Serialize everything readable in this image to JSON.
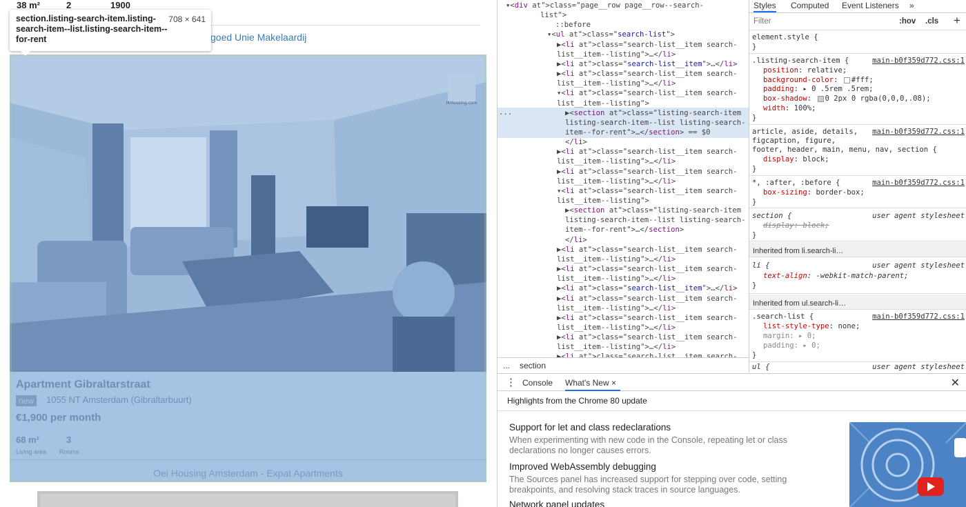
{
  "page": {
    "prev_listing": {
      "area": "38 m²",
      "rooms": "2",
      "price_short": "1900",
      "agent_partial": "goed Unie Makelaardij"
    },
    "tooltip": {
      "selector": "section.listing-search-item.listing-search-item--list.listing-search-item--for-rent",
      "dimensions": "708 × 641"
    },
    "listing": {
      "title": "Apartment Gibraltarstraat",
      "badge": "new",
      "address": "1055 NT Amsterdam (Gibraltarbuurt)",
      "price": "€1,900 per month",
      "area": "68 m²",
      "area_label": "Living area",
      "rooms": "3",
      "rooms_label": "Rooms",
      "agent": "Oei Housing Amsterdam - Expat Apartments",
      "watermark": "IKHousing.com"
    }
  },
  "devtools": {
    "elements": [
      {
        "indent": 12,
        "html": "▾<div class=\"page__row page__row--search-"
      },
      {
        "indent": 62,
        "html": "list\">"
      },
      {
        "indent": 84,
        "html": "::before"
      },
      {
        "indent": 72,
        "html": "▾<ul class=\"search-list\">"
      },
      {
        "indent": 86,
        "html": "▶<li class=\"search-list__item search-"
      },
      {
        "indent": 86,
        "html": "list__item--listing\">…</li>"
      },
      {
        "indent": 86,
        "html": "▶<li class=\"search-list__item\">…</li>"
      },
      {
        "indent": 86,
        "html": "▶<li class=\"search-list__item search-"
      },
      {
        "indent": 86,
        "html": "list__item--listing\">…</li>"
      },
      {
        "indent": 86,
        "html": "▾<li class=\"search-list__item search-"
      },
      {
        "indent": 86,
        "html": "list__item--listing\">"
      },
      {
        "indent": 98,
        "html": "▶<section class=\"listing-search-item"
      },
      {
        "indent": 98,
        "html": "listing-search-item--list listing-search-"
      },
      {
        "indent": 98,
        "html": "item--for-rent\">…</section> == $0"
      },
      {
        "indent": 98,
        "html": "</li>"
      },
      {
        "indent": 86,
        "html": "▶<li class=\"search-list__item search-"
      },
      {
        "indent": 86,
        "html": "list__item--listing\">…</li>"
      },
      {
        "indent": 86,
        "html": "▶<li class=\"search-list__item search-"
      },
      {
        "indent": 86,
        "html": "list__item--listing\">…</li>"
      },
      {
        "indent": 86,
        "html": "▾<li class=\"search-list__item search-"
      },
      {
        "indent": 86,
        "html": "list__item--listing\">"
      },
      {
        "indent": 98,
        "html": "▶<section class=\"listing-search-item"
      },
      {
        "indent": 98,
        "html": "listing-search-item--list listing-search-"
      },
      {
        "indent": 98,
        "html": "item--for-rent\">…</section>"
      },
      {
        "indent": 98,
        "html": "</li>"
      },
      {
        "indent": 86,
        "html": "▶<li class=\"search-list__item search-"
      },
      {
        "indent": 86,
        "html": "list__item--listing\">…</li>"
      },
      {
        "indent": 86,
        "html": "▶<li class=\"search-list__item search-"
      },
      {
        "indent": 86,
        "html": "list__item--listing\">…</li>"
      },
      {
        "indent": 86,
        "html": "▶<li class=\"search-list__item\">…</li>"
      },
      {
        "indent": 86,
        "html": "▶<li class=\"search-list__item search-"
      },
      {
        "indent": 86,
        "html": "list__item--listing\">…</li>"
      },
      {
        "indent": 86,
        "html": "▶<li class=\"search-list__item search-"
      },
      {
        "indent": 86,
        "html": "list__item--listing\">…</li>"
      },
      {
        "indent": 86,
        "html": "▶<li class=\"search-list__item search-"
      },
      {
        "indent": 86,
        "html": "list__item--listing\">…</li>"
      },
      {
        "indent": 86,
        "html": "▶<li class=\"search-list__item search-"
      }
    ],
    "breadcrumb": {
      "dots": "...",
      "current": "section"
    },
    "styles_tabs": [
      "Styles",
      "Computed",
      "Event Listeners",
      "»"
    ],
    "filter_placeholder": "Filter",
    "hov": ":hov",
    "cls": ".cls",
    "add": "+",
    "source_file": "main-b0f359d772.css:1",
    "ua_label": "user agent stylesheet",
    "element_style": "element.style {",
    "listing_rule": {
      "selector": ".listing-search-item {",
      "props": [
        {
          "name": "position",
          "value": "relative;"
        },
        {
          "name": "background-color",
          "value": "#fff;"
        },
        {
          "name": "padding",
          "value": "▸ 0 .5rem .5rem;"
        },
        {
          "name": "box-shadow",
          "value": "0 2px 0 rgba(0,0,0,.08);"
        },
        {
          "name": "width",
          "value": "100%;"
        }
      ]
    },
    "article_rule": {
      "lines": [
        "article, aside, details,",
        "figcaption, figure,",
        "footer, header, main, menu, nav, section {"
      ],
      "prop": "display",
      "value": "block;"
    },
    "star_rule": {
      "selector": "*, :after, :before {",
      "prop": "box-sizing",
      "value": "border-box;"
    },
    "section_ua": {
      "selector": "section {",
      "prop": "display: block;"
    },
    "inherited_li": "Inherited from li.search-li…",
    "li_rule": {
      "selector": "li {",
      "prop": "text-align",
      "value": "-webkit-match-parent;"
    },
    "inherited_ul": "Inherited from ul.search-li…",
    "ul_rule": {
      "selector": ".search-list {",
      "props": [
        {
          "name": "list-style-type",
          "value": "none;"
        },
        {
          "name": "margin",
          "value": "▸ 0;"
        },
        {
          "name": "padding",
          "value": "▸ 0;"
        }
      ]
    },
    "ul_ua": "ul {",
    "close_brace": "}",
    "drawer": {
      "menu": "⋮",
      "tabs": [
        "Console",
        "What's New"
      ],
      "close_tab": "×",
      "close": "✕",
      "highlights": "Highlights from the Chrome 80 update",
      "items": [
        {
          "title": "Support for let and class redeclarations",
          "text": "When experimenting with new code in the Console, repeating let or class declarations no longer causes errors."
        },
        {
          "title": "Improved WebAssembly debugging",
          "text": "The Sources panel has increased support for stepping over code, setting breakpoints, and resolving stack traces in source languages."
        },
        {
          "title": "Network panel updates",
          "text": ""
        }
      ]
    },
    "colors": {
      "accent": "#1a73e8",
      "highlight_overlay": "#a6c3e3",
      "link": "#3a78b5",
      "tag": "#881280",
      "attr": "#994500",
      "value": "#1a1aa6"
    }
  }
}
